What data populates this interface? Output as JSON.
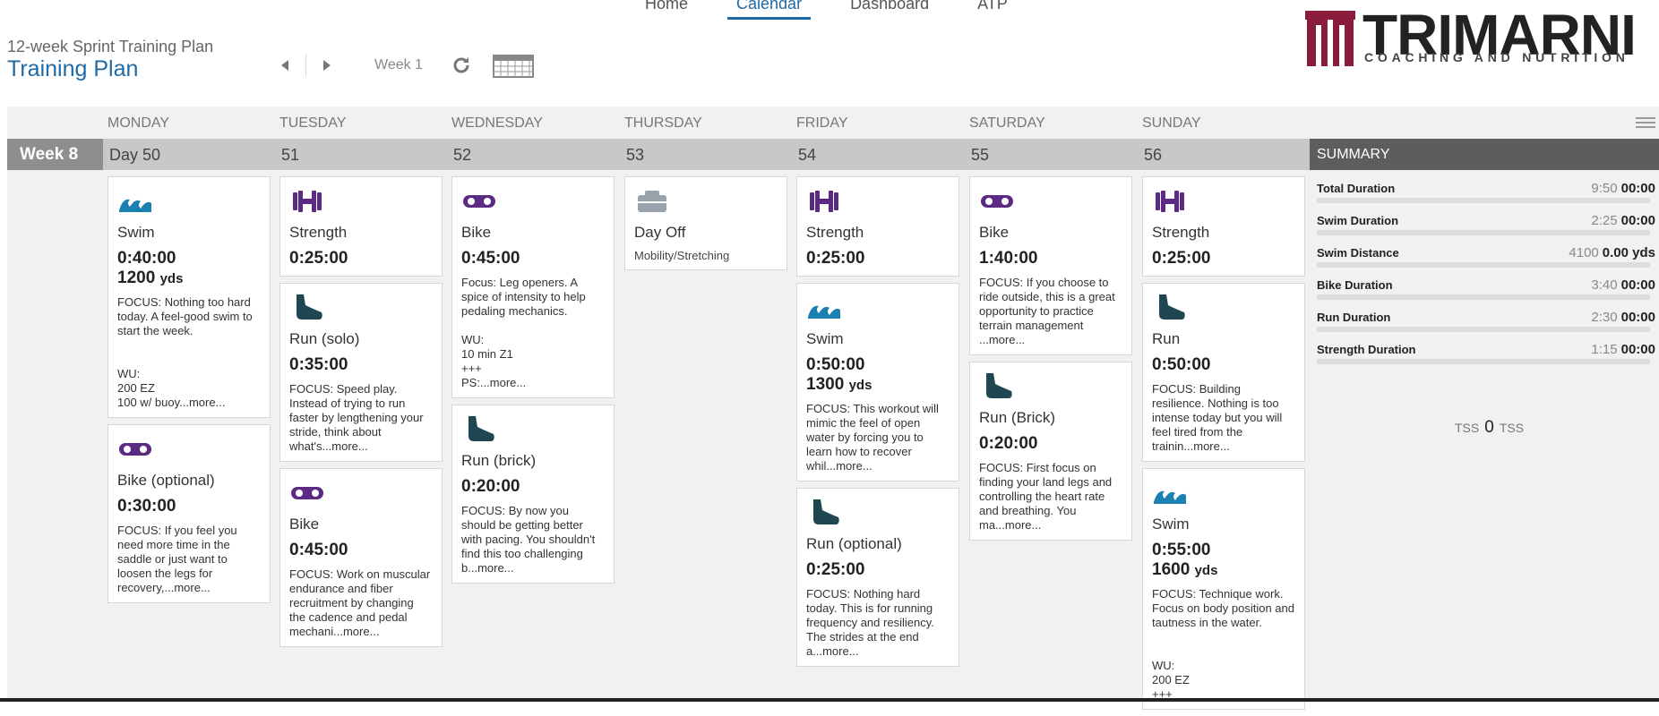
{
  "nav": {
    "items": [
      "Home",
      "Calendar",
      "Dashboard",
      "ATP"
    ],
    "active_index": 1
  },
  "header": {
    "plan_name": "12-week Sprint Training Plan",
    "title": "Training Plan",
    "week_label": "Week 1"
  },
  "logo": {
    "name": "TRIMARNI",
    "tagline": "COACHING AND NUTRITION"
  },
  "colors": {
    "accent": "#1f6aa5",
    "swim": "#1a7fb1",
    "bike": "#5b2a83",
    "strength": "#5b2a83",
    "run": "#1f4752"
  },
  "calendar": {
    "week_badge": "Week 8",
    "days": [
      {
        "dow": "MONDAY",
        "num": "Day 50"
      },
      {
        "dow": "TUESDAY",
        "num": "51"
      },
      {
        "dow": "WEDNESDAY",
        "num": "52"
      },
      {
        "dow": "THURSDAY",
        "num": "53"
      },
      {
        "dow": "FRIDAY",
        "num": "54"
      },
      {
        "dow": "SATURDAY",
        "num": "55"
      },
      {
        "dow": "SUNDAY",
        "num": "56"
      }
    ],
    "columns": [
      [
        {
          "icon": "swim-icon",
          "title": "Swim",
          "duration": "0:40:00",
          "distance": "1200",
          "unit": "yds",
          "desc": "FOCUS: Nothing too hard today. A feel-good swim to start the week.\n\n\nWU:\n200 EZ\n100 w/ buoy...more..."
        },
        {
          "icon": "bike-icon",
          "title": "Bike (optional)",
          "duration": "0:30:00",
          "desc": "FOCUS: If you feel you need more time in the saddle or just want to loosen the legs for recovery,...more..."
        }
      ],
      [
        {
          "icon": "strength-icon",
          "title": "Strength",
          "duration": "0:25:00"
        },
        {
          "icon": "run-icon",
          "title": "Run (solo)",
          "duration": "0:35:00",
          "desc": "FOCUS: Speed play. Instead of trying to run faster by lengthening your stride, think about what's...more..."
        },
        {
          "icon": "bike-icon",
          "title": "Bike",
          "duration": "0:45:00",
          "desc": "FOCUS: Work on muscular endurance and fiber recruitment by changing the cadence and pedal mechani...more..."
        }
      ],
      [
        {
          "icon": "bike-icon",
          "title": "Bike",
          "duration": "0:45:00",
          "desc": "Focus: Leg openers. A spice of intensity to help pedaling mechanics.\n\nWU:\n10 min Z1\n+++\nPS:...more..."
        },
        {
          "icon": "run-icon",
          "title": "Run (brick)",
          "duration": "0:20:00",
          "desc": "FOCUS: By now you should be getting better with pacing. You shouldn't find this too challenging b...more..."
        }
      ],
      [
        {
          "icon": "day-off-icon",
          "title": "Day Off",
          "sub": "Mobility/Stretching"
        }
      ],
      [
        {
          "icon": "strength-icon",
          "title": "Strength",
          "duration": "0:25:00"
        },
        {
          "icon": "swim-icon",
          "title": "Swim",
          "duration": "0:50:00",
          "distance": "1300",
          "unit": "yds",
          "desc": "FOCUS: This workout will mimic the feel of open water by forcing you to learn how to recover whil...more..."
        },
        {
          "icon": "run-icon",
          "title": "Run (optional)",
          "duration": "0:25:00",
          "desc": "FOCUS: Nothing hard today. This is for running frequency and resiliency. The strides at the end a...more..."
        }
      ],
      [
        {
          "icon": "bike-icon",
          "title": "Bike",
          "duration": "1:40:00",
          "desc": "FOCUS: If you choose to ride outside, this is a great opportunity to practice terrain management ...more..."
        },
        {
          "icon": "run-icon",
          "title": "Run (Brick)",
          "duration": "0:20:00",
          "desc": "FOCUS: First focus on finding your land legs and controlling the heart rate and breathing. You ma...more..."
        }
      ],
      [
        {
          "icon": "strength-icon",
          "title": "Strength",
          "duration": "0:25:00"
        },
        {
          "icon": "run-icon",
          "title": "Run",
          "duration": "0:50:00",
          "desc": "FOCUS: Building resilience. Nothing is too intense today but you will feel tired from the trainin...more..."
        },
        {
          "icon": "swim-icon",
          "title": "Swim",
          "duration": "0:55:00",
          "distance": "1600",
          "unit": "yds",
          "desc": "FOCUS: Technique work. Focus on body position and tautness in the water.\n\n\nWU:\n200 EZ\n+++"
        }
      ]
    ]
  },
  "summary": {
    "header": "SUMMARY",
    "rows": [
      {
        "label": "Total Duration",
        "planned": "9:50",
        "completed": "00:00",
        "unit": ""
      },
      {
        "label": "Swim Duration",
        "planned": "2:25",
        "completed": "00:00",
        "unit": ""
      },
      {
        "label": "Swim Distance",
        "planned": "4100",
        "completed": "0.00",
        "unit": "yds"
      },
      {
        "label": "Bike Duration",
        "planned": "3:40",
        "completed": "00:00",
        "unit": ""
      },
      {
        "label": "Run Duration",
        "planned": "2:30",
        "completed": "00:00",
        "unit": ""
      },
      {
        "label": "Strength Duration",
        "planned": "1:15",
        "completed": "00:00",
        "unit": ""
      }
    ],
    "tss_prefix": "TSS",
    "tss_value": "0",
    "tss_suffix": "TSS"
  }
}
